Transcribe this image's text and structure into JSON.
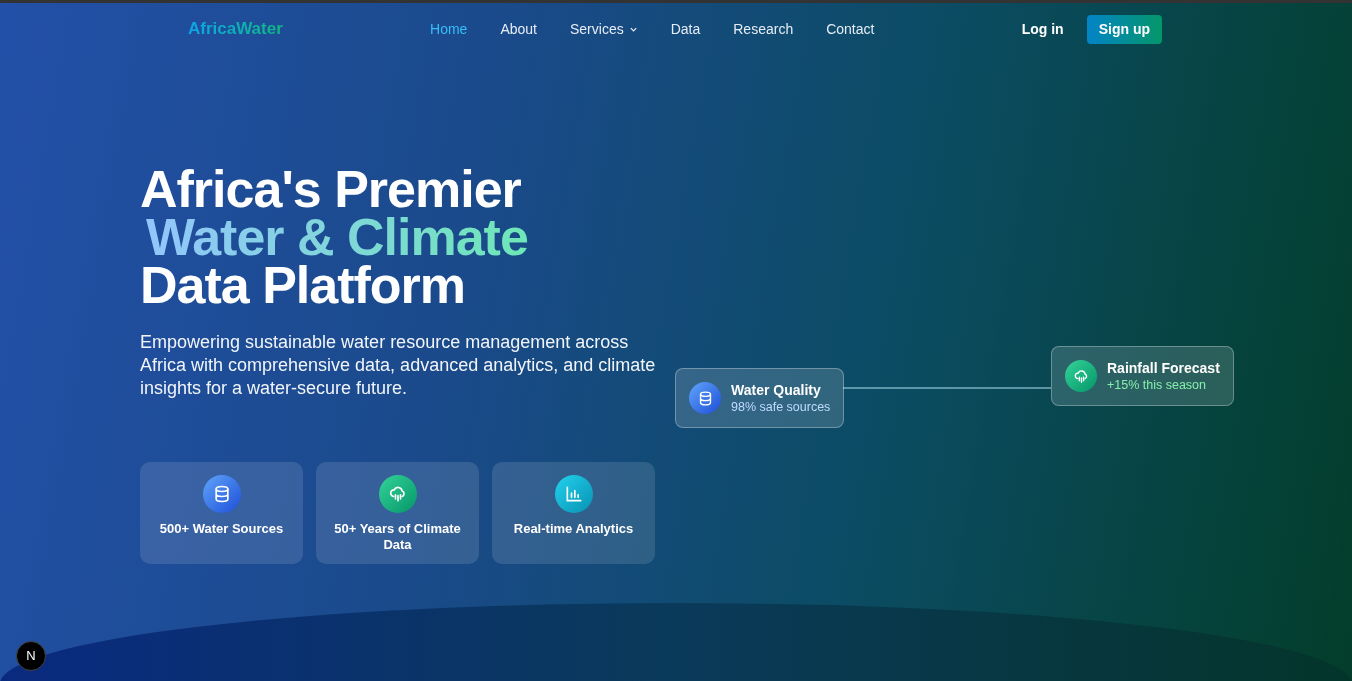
{
  "brand": "AfricaWater",
  "nav": [
    {
      "label": "Home",
      "selected": true,
      "has_menu": false
    },
    {
      "label": "About",
      "selected": false,
      "has_menu": false
    },
    {
      "label": "Services",
      "selected": false,
      "has_menu": true
    },
    {
      "label": "Data",
      "selected": false,
      "has_menu": false
    },
    {
      "label": "Research",
      "selected": false,
      "has_menu": false
    },
    {
      "label": "Contact",
      "selected": false,
      "has_menu": false
    }
  ],
  "auth": {
    "login": "Log in",
    "signup": "Sign up"
  },
  "hero": {
    "title_lines": [
      {
        "text": "Africa's Premier",
        "highlight": false
      },
      {
        "text": "Water & Climate",
        "highlight": true
      },
      {
        "text": "Data Platform",
        "highlight": false
      }
    ],
    "description": "Empowering sustainable water resource management across Africa with comprehensive data, advanced analytics, and climate insights for a water-secure future.",
    "features": [
      {
        "kind": "database",
        "label": "500+ Water Sources"
      },
      {
        "kind": "cloud-rain",
        "label": "50+ Years of Climate Data"
      },
      {
        "kind": "chart",
        "label": "Real-time Analytics"
      }
    ]
  },
  "diagram": {
    "nodes": [
      {
        "kind": "database",
        "title": "Water Quality",
        "subtitle": "98% safe sources"
      },
      {
        "kind": "cloud-rain",
        "title": "Rainfall Forecast",
        "subtitle": "+15% this season"
      }
    ]
  },
  "dev_badge": "N"
}
